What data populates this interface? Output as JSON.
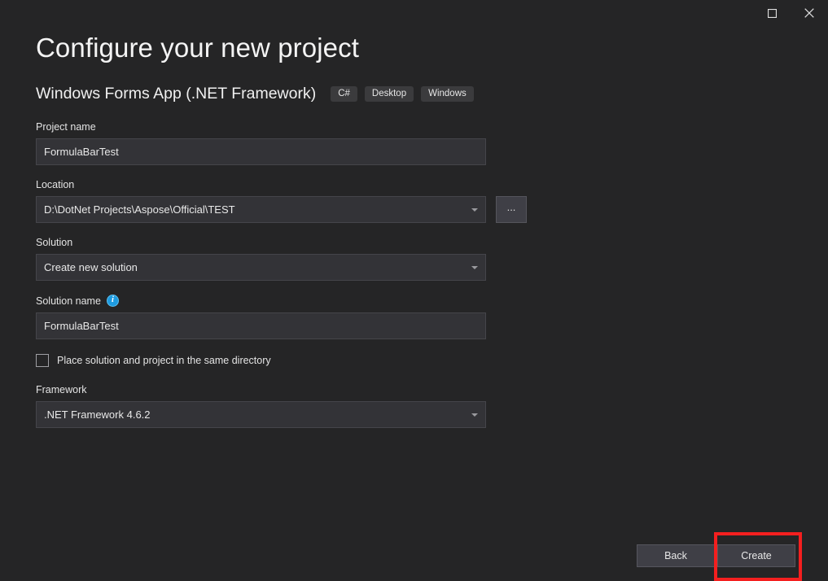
{
  "window": {
    "maximize_label": "Maximize",
    "close_label": "Close"
  },
  "header": {
    "title": "Configure your new project",
    "template_name": "Windows Forms App (.NET Framework)",
    "tags": [
      "C#",
      "Desktop",
      "Windows"
    ]
  },
  "form": {
    "project_name": {
      "label": "Project name",
      "value": "FormulaBarTest"
    },
    "location": {
      "label": "Location",
      "value": "D:\\DotNet Projects\\Aspose\\Official\\TEST",
      "browse_label": "..."
    },
    "solution": {
      "label": "Solution",
      "value": "Create new solution"
    },
    "solution_name": {
      "label": "Solution name",
      "value": "FormulaBarTest",
      "info_glyph": "i"
    },
    "same_directory": {
      "label": "Place solution and project in the same directory",
      "checked": false
    },
    "framework": {
      "label": "Framework",
      "value": ".NET Framework 4.6.2"
    }
  },
  "footer": {
    "back_label": "Back",
    "create_label": "Create"
  },
  "colors": {
    "background": "#252526",
    "field": "#333337",
    "button": "#3f3f46",
    "accent_info": "#1e9be0",
    "annotation": "#f41f1f"
  }
}
